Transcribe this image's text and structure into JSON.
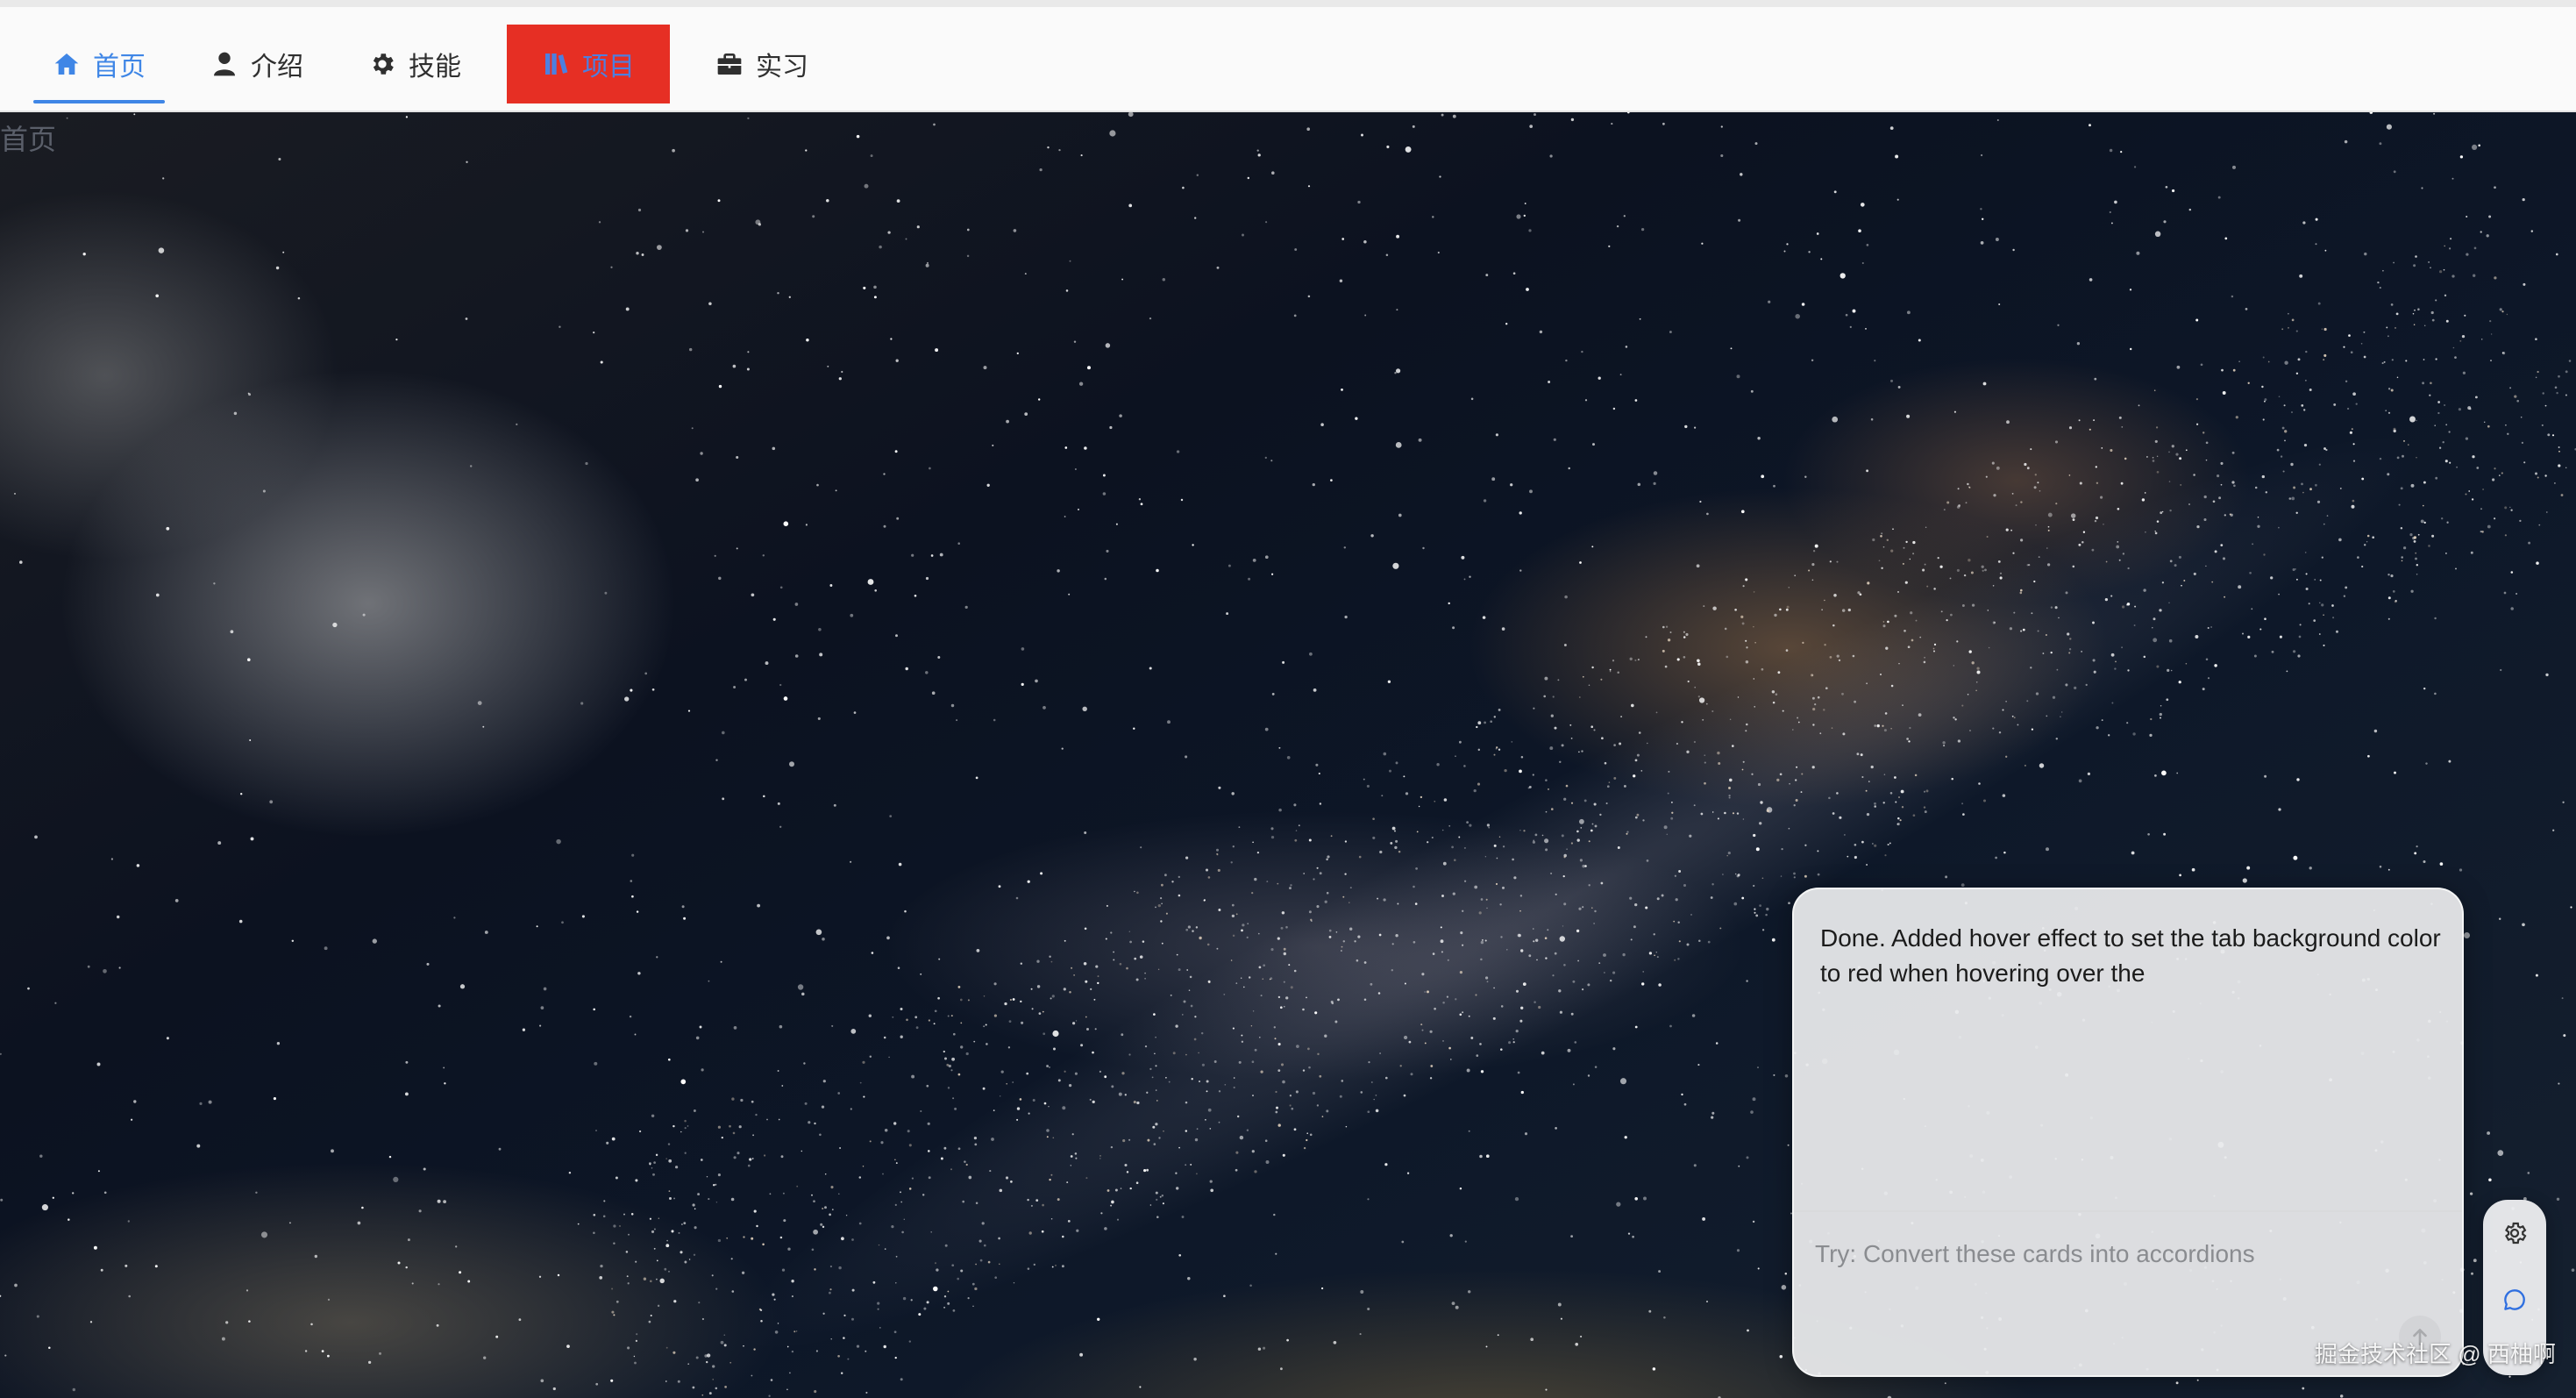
{
  "nav": {
    "tabs": [
      {
        "label": "首页",
        "icon": "home-icon",
        "state": "active"
      },
      {
        "label": "介绍",
        "icon": "user-icon",
        "state": "normal"
      },
      {
        "label": "技能",
        "icon": "gear-icon",
        "state": "normal"
      },
      {
        "label": "项目",
        "icon": "book-icon",
        "state": "hover"
      },
      {
        "label": "实习",
        "icon": "briefcase-icon",
        "state": "normal"
      }
    ],
    "active_color": "#3f86e6",
    "hover_background": "#e62f24"
  },
  "hero": {
    "label": "首页"
  },
  "chat": {
    "message": "Done. Added hover effect to set the tab background color to red when hovering over the",
    "input_value": "",
    "input_placeholder": "Try: Convert these cards into accordions",
    "send_icon": "arrow-up-icon"
  },
  "tool_rail": {
    "settings_icon": "gear-icon",
    "chat_icon": "chat-bubble-icon"
  },
  "watermark": "掘金技术社区 @ 西柚啊"
}
